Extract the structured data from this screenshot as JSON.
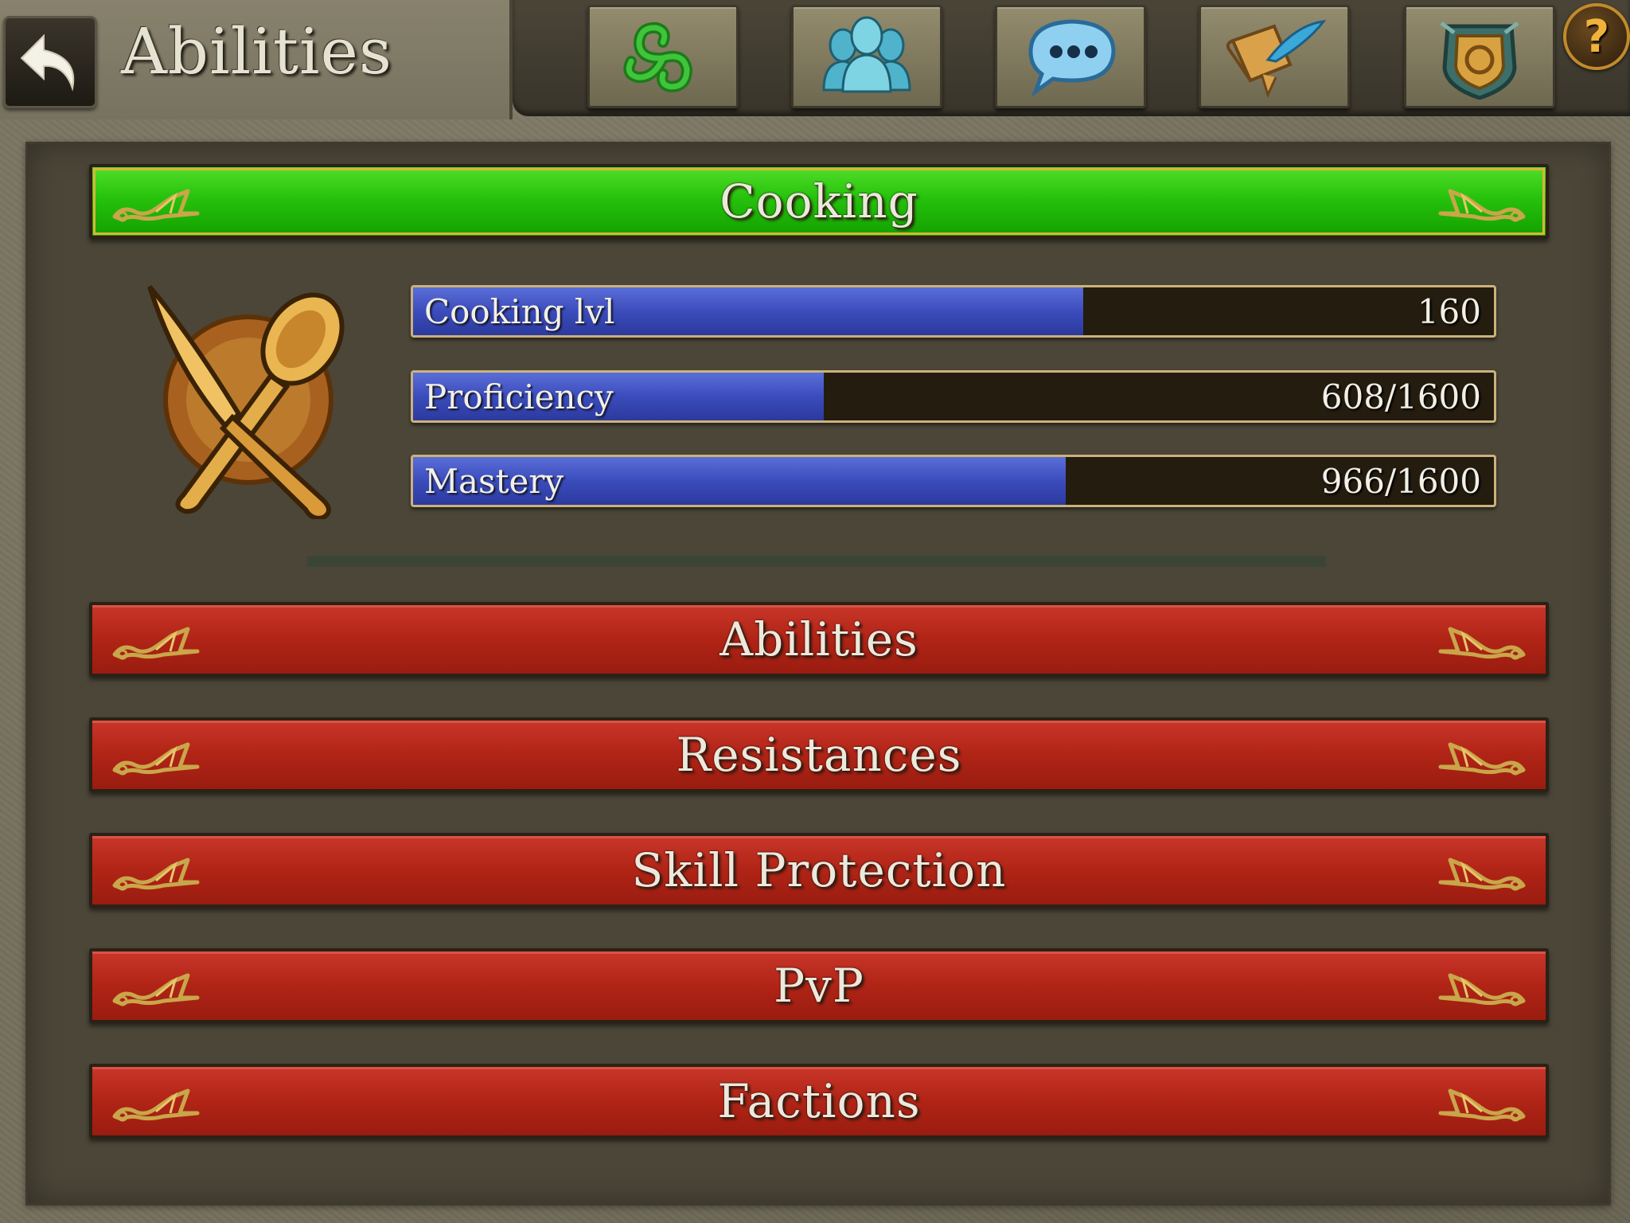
{
  "header": {
    "title": "Abilities",
    "nav_icons": [
      "triskele-icon",
      "group-icon",
      "chat-bubble-icon",
      "scroll-quill-icon",
      "guild-shield-icon"
    ],
    "help_label": "?"
  },
  "current_skill": {
    "name": "Cooking",
    "icon": "crossed-knife-spoon-icon",
    "stats": [
      {
        "label": "Cooking lvl",
        "value": "160",
        "progress": 0.62
      },
      {
        "label": "Proficiency",
        "value": "608/1600",
        "progress": 0.38
      },
      {
        "label": "Mastery",
        "value": "966/1600",
        "progress": 0.604
      }
    ]
  },
  "sections": [
    {
      "label": "Abilities"
    },
    {
      "label": "Resistances"
    },
    {
      "label": "Skill Protection"
    },
    {
      "label": "PvP"
    },
    {
      "label": "Factions"
    }
  ],
  "colors": {
    "active_banner": "#26c20c",
    "section_banner": "#b02416",
    "progress_fill": "#3b4cbc",
    "ornament": "#c9a64a"
  }
}
